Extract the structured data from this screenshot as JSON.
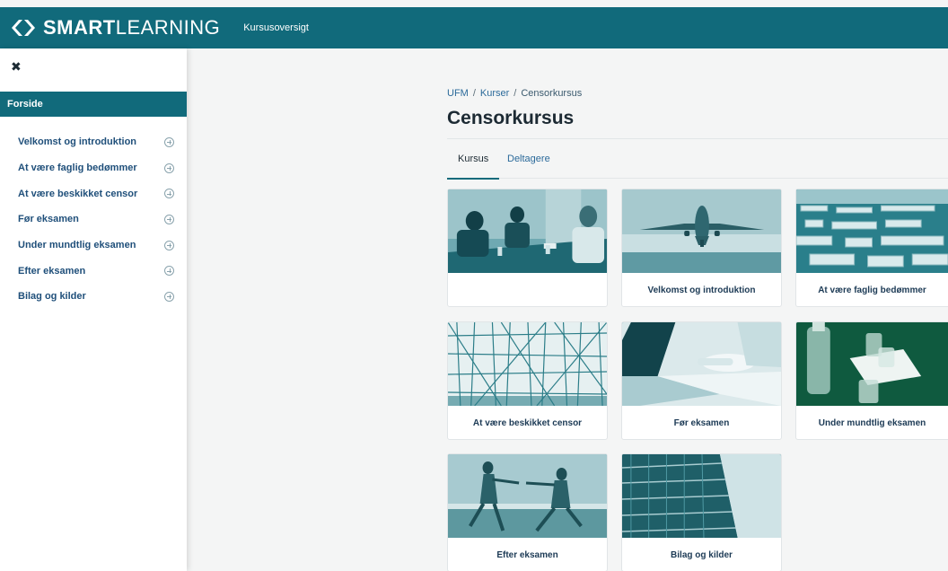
{
  "header": {
    "logo_bold": "SMART",
    "logo_light": "LEARNING",
    "nav_link": "Kursusoversigt",
    "brand_color": "#116a7b"
  },
  "sidebar": {
    "close_icon": "close-icon",
    "close_glyph": "✖",
    "forside": "Forside",
    "items": [
      {
        "label": "Velkomst og introduktion",
        "icon": "plus-circle-icon"
      },
      {
        "label": "At være faglig bedømmer",
        "icon": "plus-circle-icon"
      },
      {
        "label": "At være beskikket censor",
        "icon": "plus-circle-icon"
      },
      {
        "label": "Før eksamen",
        "icon": "plus-circle-icon"
      },
      {
        "label": "Under mundtlig eksamen",
        "icon": "plus-circle-icon"
      },
      {
        "label": "Efter eksamen",
        "icon": "plus-circle-icon"
      },
      {
        "label": "Bilag og kilder",
        "icon": "plus-circle-icon"
      }
    ]
  },
  "breadcrumb": {
    "items": [
      "UFM",
      "Kurser",
      "Censorkursus"
    ],
    "separator": "/"
  },
  "page": {
    "title": "Censorkursus"
  },
  "tabs": [
    {
      "label": "Kursus",
      "active": true
    },
    {
      "label": "Deltagere",
      "active": false
    }
  ],
  "cards": [
    {
      "label": "",
      "image": "meeting-image"
    },
    {
      "label": "Velkomst og introduktion",
      "image": "airplane-image"
    },
    {
      "label": "At være faglig bedømmer",
      "image": "maze-image"
    },
    {
      "label": "At være beskikket censor",
      "image": "scaffold-image"
    },
    {
      "label": "Før eksamen",
      "image": "laptop-image"
    },
    {
      "label": "Under mundtlig eksamen",
      "image": "glasses-image"
    },
    {
      "label": "Efter eksamen",
      "image": "runners-image"
    },
    {
      "label": "Bilag og kilder",
      "image": "library-image"
    }
  ]
}
